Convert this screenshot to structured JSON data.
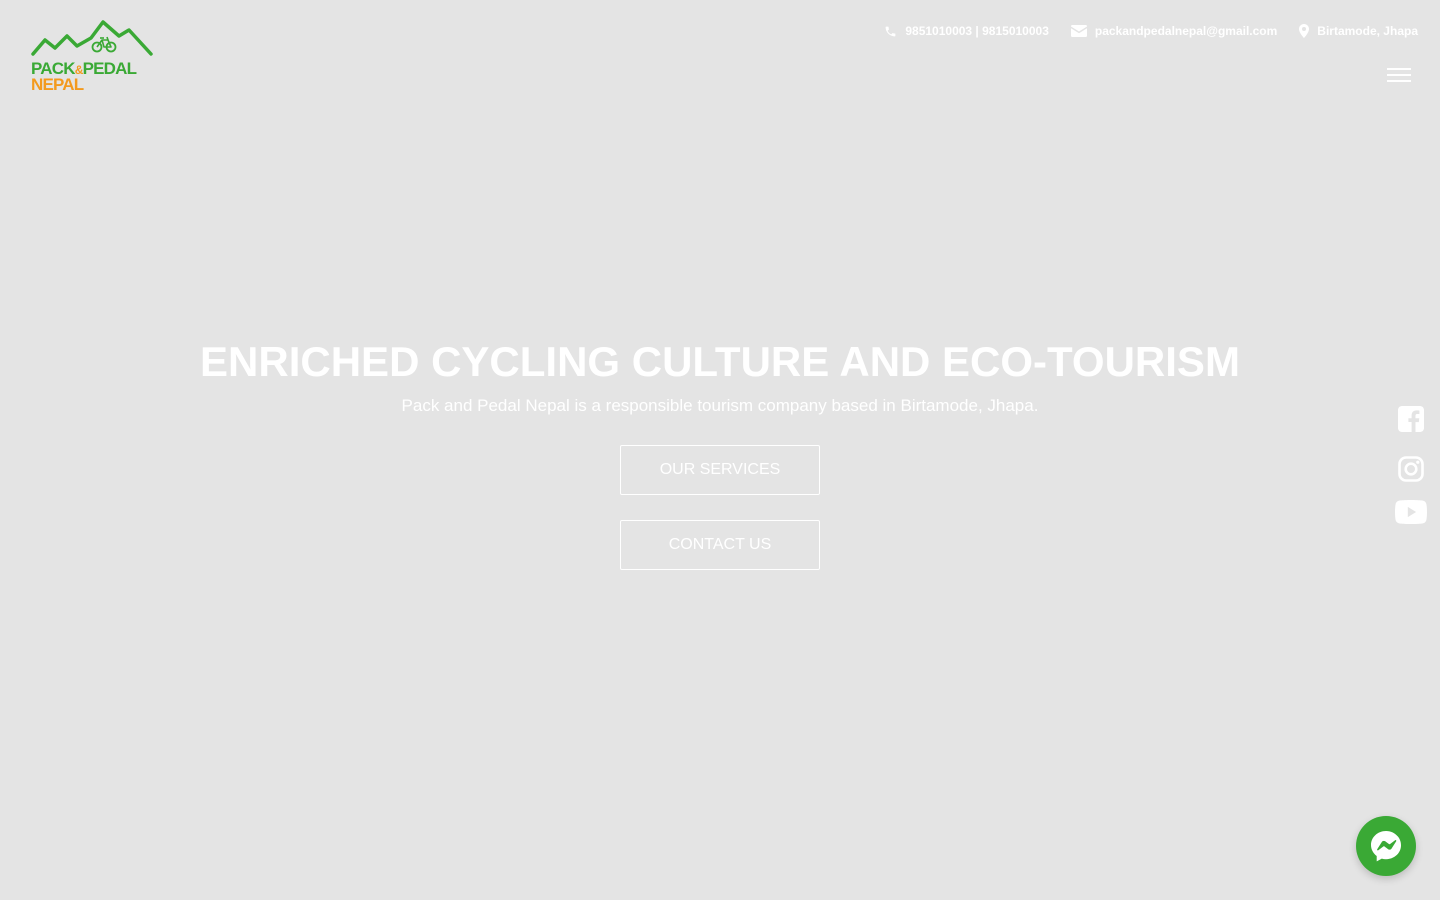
{
  "brand": {
    "logo_line1": "PACK",
    "logo_amp": "&",
    "logo_line1b": "PEDAL",
    "logo_line2": "NEPAL",
    "colors": {
      "green": "#3aa935",
      "orange": "#f39a1e"
    }
  },
  "contact": {
    "phone": "9851010003 | 9815010003",
    "email": "packandpedalnepal@gmail.com",
    "location": "Birtamode, Jhapa",
    "icons": [
      "phone-icon",
      "envelope-icon",
      "map-marker-icon"
    ]
  },
  "hero": {
    "title": "ENRICHED CYCLING CULTURE AND ECO-TOURISM",
    "subtitle": "Pack and Pedal Nepal is a responsible tourism company based in Birtamode, Jhapa.",
    "primary_button": "OUR SERVICES",
    "secondary_button": "CONTACT US"
  },
  "social": [
    "facebook-icon",
    "instagram-icon",
    "youtube-icon"
  ],
  "chat": {
    "icon": "messenger-icon",
    "color": "#3aa935"
  }
}
